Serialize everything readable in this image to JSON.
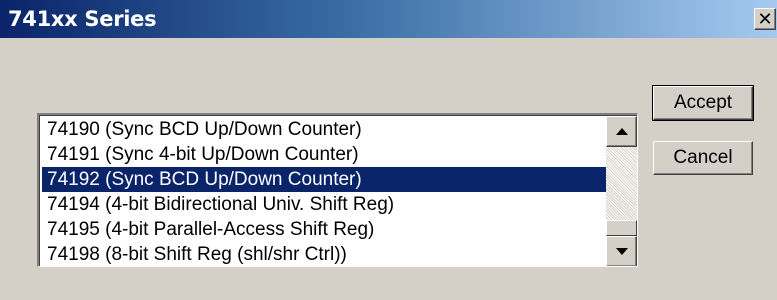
{
  "window": {
    "title": "741xx Series",
    "close_glyph": "✕"
  },
  "list": {
    "items": [
      "74190 (Sync BCD Up/Down Counter)",
      "74191 (Sync 4-bit Up/Down Counter)",
      "74192 (Sync BCD Up/Down Counter)",
      "74194 (4-bit Bidirectional Univ. Shift Reg)",
      "74195 (4-bit Parallel-Access Shift Reg)",
      "74198 (8-bit Shift Reg (shl/shr Ctrl))"
    ],
    "selected_index": 2
  },
  "buttons": {
    "accept_label": "Accept",
    "cancel_label": "Cancel"
  },
  "colors": {
    "selection_bg": "#0a246a",
    "selection_fg": "#ffffff",
    "face": "#d4d0c8"
  },
  "icons": {
    "close": "close-icon",
    "scroll_up": "up-arrow-icon",
    "scroll_down": "down-arrow-icon"
  }
}
